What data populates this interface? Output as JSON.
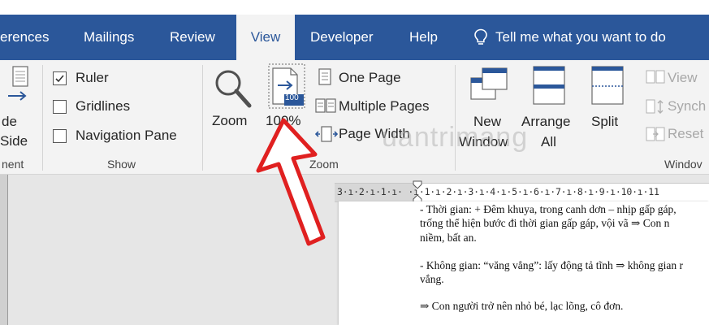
{
  "tabs": [
    {
      "label": "erences",
      "active": false
    },
    {
      "label": "Mailings",
      "active": false
    },
    {
      "label": "Review",
      "active": false
    },
    {
      "label": "View",
      "active": true
    },
    {
      "label": "Developer",
      "active": false
    },
    {
      "label": "Help",
      "active": false
    }
  ],
  "tell_me": {
    "icon": "lightbulb-icon",
    "label": "Tell me what you want to do"
  },
  "ribbon": {
    "views_group": {
      "line1": "de",
      "line2": "Side",
      "label": "nent"
    },
    "show_group": {
      "label": "Show",
      "ruler": {
        "label": "Ruler",
        "checked": true
      },
      "gridlines": {
        "label": "Gridlines",
        "checked": false
      },
      "navigation_pane": {
        "label": "Navigation Pane",
        "checked": false
      }
    },
    "zoom_group": {
      "label": "Zoom",
      "zoom_label": "Zoom",
      "hundred_label": "100%",
      "hundred_badge": "100",
      "one_page": "One Page",
      "multiple_pages": "Multiple Pages",
      "page_width": "Page Width"
    },
    "window_group": {
      "label": "Windov",
      "new_window_line1": "New",
      "new_window_line2": "Window",
      "arrange_line1": "Arrange",
      "arrange_line2": "All",
      "split": "Split",
      "view_side": "View",
      "synch": "Synch",
      "reset": "Reset"
    }
  },
  "ruler": {
    "text": "3·ı·2·ı·1·ı·  ·ı·1·ı·2·ı·3·ı·4·ı·5·ı·6·ı·7·ı·8·ı·9·ı·10·ı·11"
  },
  "document": {
    "paragraphs": [
      "- Thời gian: + Đêm khuya, trong canh dơn – nhịp gấp gáp,",
      "trống thể hiện bước đi thời gian gấp gáp, vội vã ⇒ Con n",
      "niềm, bất an.",
      "- Không gian: “văng vẳng”: lấy động tả tĩnh ⇒ không gian r",
      "vắng.",
      "⇒ Con người trở nên nhỏ bé, lạc lõng, cô đơn."
    ]
  },
  "watermark": "uantrimang",
  "colors": {
    "tab_bar": "#2b579a",
    "ribbon": "#f3f3f3",
    "arrow": "#e02020",
    "icon_blue": "#2b579a"
  }
}
